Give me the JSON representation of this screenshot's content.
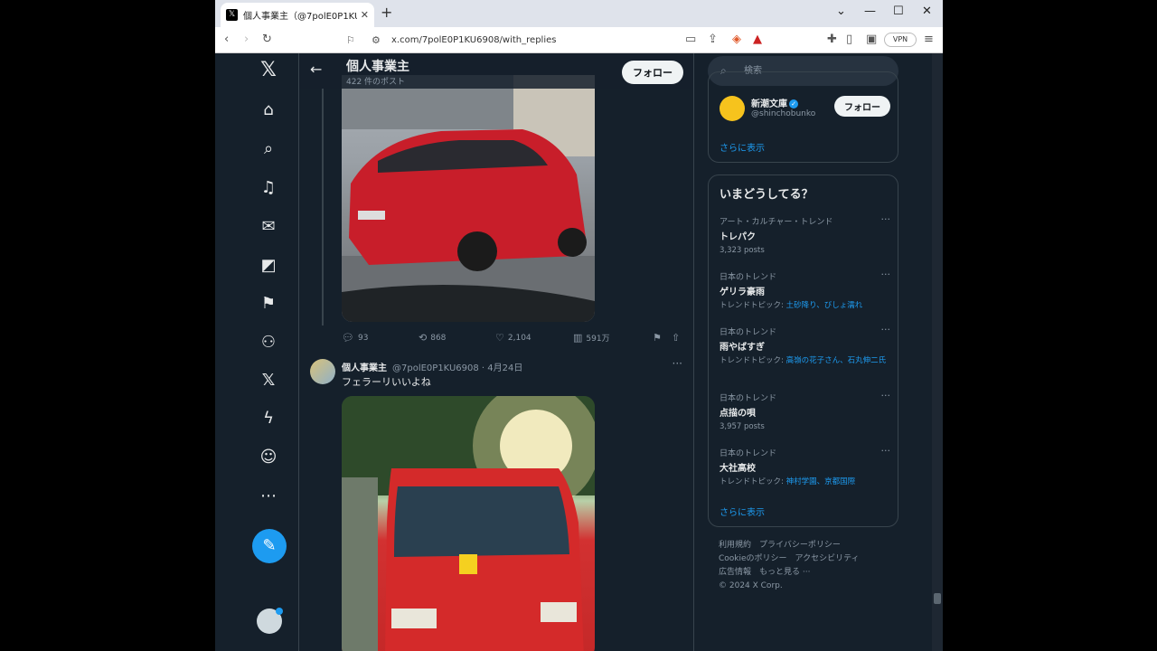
{
  "browser": {
    "tab_title": "個人事業主（@7polE0P1KU69(",
    "url": "x.com/7polE0P1KU6908/with_replies",
    "vpn_label": "VPN"
  },
  "header": {
    "title": "個人事業主",
    "post_count": "422 件のポスト",
    "follow_label": "フォロー"
  },
  "tweet1": {
    "replies": "93",
    "retweets": "868",
    "likes": "2,104",
    "views": "591万"
  },
  "tweet2": {
    "name": "個人事業主",
    "handle": "@7polE0P1KU6908 · 4月24日",
    "text": "フェラーリいいよね"
  },
  "search": {
    "placeholder": "検索"
  },
  "who_to_follow": {
    "name": "新潮文庫",
    "handle": "@shinchobunko",
    "follow_label": "フォロー",
    "show_more": "さらに表示"
  },
  "trends": {
    "heading": "いまどうしてる？",
    "items": [
      {
        "category": "アート・カルチャー・トレンド",
        "name": "トレパク",
        "meta": "3,323 posts",
        "topics": ""
      },
      {
        "category": "日本のトレンド",
        "name": "ゲリラ豪雨",
        "meta": "トレンドトピック: ",
        "topics": "土砂降り、びしょ濡れ"
      },
      {
        "category": "日本のトレンド",
        "name": "雨やばすぎ",
        "meta": "トレンドトピック: ",
        "topics": "高嶺の花子さん、石丸伸二氏"
      },
      {
        "category": "日本のトレンド",
        "name": "点描の唄",
        "meta": "3,957 posts",
        "topics": ""
      },
      {
        "category": "日本のトレンド",
        "name": "大社高校",
        "meta": "トレンドトピック: ",
        "topics": "神村学園、京都国際"
      }
    ],
    "show_more": "さらに表示"
  },
  "footer": {
    "line1": "利用規約　プライバシーポリシー",
    "line2": "Cookieのポリシー　アクセシビリティ",
    "line3": "広告情報　もっと見る ···",
    "line4": "© 2024 X Corp."
  },
  "icons": [
    "x-logo-icon",
    "home-icon",
    "search-icon",
    "bell-icon",
    "mail-icon",
    "grok-icon",
    "bookmark-icon",
    "communities-icon",
    "premium-icon",
    "lightning-icon",
    "profile-icon",
    "more-icon",
    "compose-icon"
  ],
  "colors": {
    "accent": "#1d9bf0",
    "background": "#15202b",
    "border": "#38444d"
  }
}
